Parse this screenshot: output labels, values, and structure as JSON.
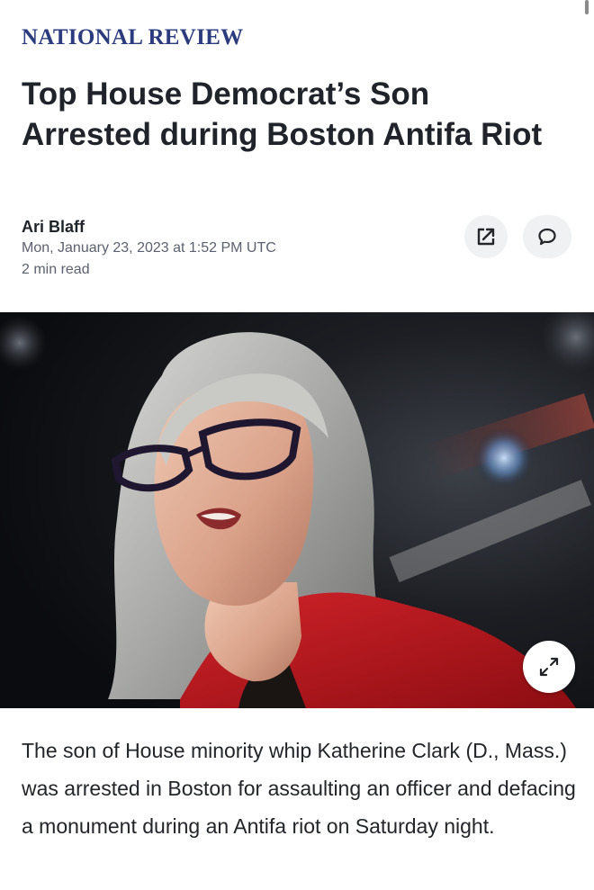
{
  "publisher": "NATIONAL REVIEW",
  "article": {
    "headline": "Top House Democrat’s Son Arrested during Boston Antifa Riot",
    "author": "Ari Blaff",
    "date": "Mon, January 23, 2023 at 1:52 PM UTC",
    "read_time": "2 min read",
    "body": "The son of House minority whip Katherine Clark (D., Mass.) was arrested in Boston for assaulting an officer and defacing a monument during an Antifa riot on Saturday night."
  },
  "actions": {
    "share_icon": "share-external-icon",
    "comment_icon": "comment-bubble-icon",
    "expand_icon": "expand-arrows-icon"
  },
  "colors": {
    "publisher": "#2b3b7e",
    "headline": "#20232a",
    "meta": "#5b616e",
    "photo_jacket": "#b8141a"
  }
}
